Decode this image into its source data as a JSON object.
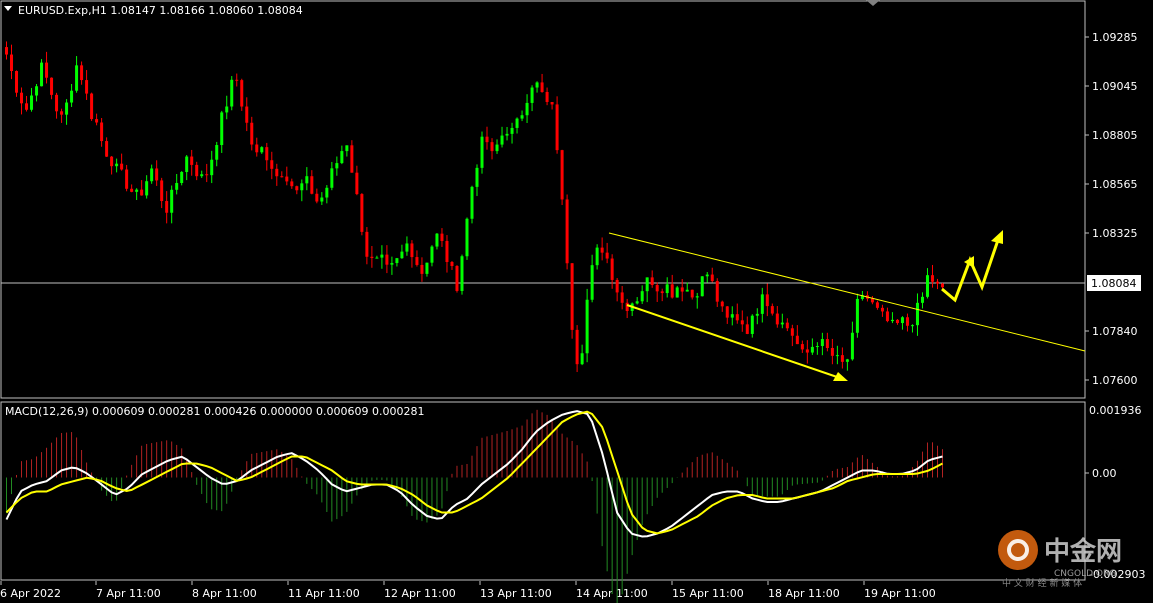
{
  "header": {
    "symbol_line": "EURUSD.Exp,H1  1.08147 1.08166 1.08060 1.08084",
    "macd_line": "MACD(12,26,9) 0.000609 0.000281 0.000426 0.000000 0.000609 0.000281"
  },
  "price_axis": {
    "ticks": [
      "1.09285",
      "1.09045",
      "1.08805",
      "1.08565",
      "1.08325",
      "1.07840",
      "1.07600"
    ],
    "tick_values": [
      1.09285,
      1.09045,
      1.08805,
      1.08565,
      1.08325,
      1.0784,
      1.076
    ],
    "current_price_label": "1.08084",
    "current_price": 1.08084
  },
  "macd_axis": {
    "ticks": [
      "0.001936",
      "0.00",
      "-0.002903"
    ]
  },
  "time_axis": {
    "labels": [
      "6 Apr 2022",
      "7 Apr 11:00",
      "8 Apr 11:00",
      "11 Apr 11:00",
      "12 Apr 11:00",
      "13 Apr 11:00",
      "14 Apr 11:00",
      "15 Apr 11:00",
      "18 Apr 11:00",
      "19 Apr 11:00"
    ]
  },
  "watermark": {
    "brand": "中金网",
    "domain": "CNGOLD.ORG",
    "tagline": "中 文 财 经 新 媒 体"
  },
  "colors": {
    "background": "#000000",
    "bull": "#00ff00",
    "bear": "#ff0000",
    "macd_main": "#ffffff",
    "macd_signal": "#ffff00",
    "hist_pos": "#b22222",
    "hist_neg": "#228b22",
    "annotation": "#ffff00",
    "grid": "#c0c0c0"
  },
  "chart_data": {
    "type": "candlestick",
    "symbol": "EURUSD.Exp",
    "timeframe": "H1",
    "ohlc_last": {
      "open": 1.08147,
      "high": 1.08166,
      "low": 1.0806,
      "close": 1.08084
    },
    "ylim": [
      1.0752,
      1.0962
    ],
    "price_path": [
      1.0935,
      1.0922,
      1.0912,
      1.0905,
      1.0918,
      1.0928,
      1.092,
      1.0908,
      1.09,
      1.0912,
      1.093,
      1.0922,
      1.0905,
      1.0898,
      1.0885,
      1.088,
      1.0872,
      1.0868,
      1.0862,
      1.0858,
      1.0866,
      1.0874,
      1.0862,
      1.0852,
      1.086,
      1.0872,
      1.088,
      1.0876,
      1.0868,
      1.0872,
      1.0885,
      1.09,
      1.0912,
      1.0925,
      1.0908,
      1.0892,
      1.088,
      1.0885,
      1.0878,
      1.087,
      1.0874,
      1.0866,
      1.086,
      1.0868,
      1.0862,
      1.0855,
      1.0862,
      1.0872,
      1.088,
      1.089,
      1.087,
      1.0848,
      1.0828,
      1.0822,
      1.0825,
      1.0818,
      1.0822,
      1.0828,
      1.0835,
      1.0825,
      1.0818,
      1.083,
      1.0838,
      1.0832,
      1.082,
      1.0812,
      1.0835,
      1.0862,
      1.088,
      1.0892,
      1.088,
      1.0888,
      1.0896,
      1.0893,
      1.09,
      1.0912,
      1.0922,
      1.0915,
      1.0908,
      1.0904,
      1.086,
      1.082,
      1.077,
      1.0778,
      1.0812,
      1.0828,
      1.0832,
      1.0822,
      1.081,
      1.08,
      1.0802,
      1.0805,
      1.0812,
      1.0815,
      1.081,
      1.0812,
      1.0808,
      1.0812,
      1.081,
      1.0805,
      1.0812,
      1.0818,
      1.081,
      1.0798,
      1.0792,
      1.0796,
      1.0792,
      1.0788,
      1.0795,
      1.081,
      1.08,
      1.0795,
      1.079,
      1.0788,
      1.078,
      1.0772,
      1.0778,
      1.0782,
      1.0778,
      1.0774,
      1.077,
      1.0768,
      1.0782,
      1.0808,
      1.0805,
      1.08,
      1.0795,
      1.0792,
      1.0788,
      1.0792,
      1.079,
      1.0795,
      1.0803,
      1.0818,
      1.0811,
      1.0808
    ],
    "macd_main_path": [
      -0.0012,
      -0.0004,
      -0.0002,
      -0.0001,
      0.0002,
      0.0003,
      0.0001,
      -0.0002,
      -0.0005,
      -0.0003,
      0.0001,
      0.0003,
      0.0005,
      0.0006,
      0.0003,
      0.0,
      -0.0002,
      -0.0001,
      0.0002,
      0.0004,
      0.0006,
      0.0007,
      0.0005,
      0.0002,
      -0.0002,
      -0.0004,
      -0.0003,
      -0.0002,
      -0.0002,
      -0.0004,
      -0.0008,
      -0.0011,
      -0.0012,
      -0.0008,
      -0.0006,
      -0.0002,
      0.0001,
      0.0004,
      0.0008,
      0.0013,
      0.0016,
      0.0018,
      0.0019,
      0.0018,
      0.0006,
      -0.001,
      -0.0016,
      -0.0017,
      -0.0016,
      -0.0014,
      -0.0011,
      -0.0008,
      -0.0005,
      -0.0004,
      -0.0004,
      -0.0006,
      -0.0007,
      -0.0007,
      -0.0006,
      -0.0005,
      -0.0004,
      -0.0002,
      0.0,
      0.0002,
      0.0002,
      0.0001,
      0.0001,
      0.0002,
      0.0005,
      0.0006
    ],
    "macd_signal_path": [
      -0.001,
      -0.0006,
      -0.0004,
      -0.0004,
      -0.0002,
      -0.0001,
      0.0,
      -0.0001,
      -0.0003,
      -0.0004,
      -0.0002,
      0.0,
      0.0002,
      0.0004,
      0.0004,
      0.0003,
      0.0001,
      -0.0001,
      0.0,
      0.0002,
      0.0004,
      0.0006,
      0.0006,
      0.0004,
      0.0002,
      -0.0001,
      -0.0002,
      -0.0002,
      -0.0002,
      -0.0003,
      -0.0005,
      -0.0008,
      -0.001,
      -0.001,
      -0.0008,
      -0.0006,
      -0.0003,
      0.0,
      0.0004,
      0.0008,
      0.0012,
      0.0016,
      0.0018,
      0.0019,
      0.0014,
      0.0002,
      -0.001,
      -0.0015,
      -0.0016,
      -0.0015,
      -0.0013,
      -0.0011,
      -0.0008,
      -0.0006,
      -0.0005,
      -0.0005,
      -0.0006,
      -0.0006,
      -0.0006,
      -0.0005,
      -0.0004,
      -0.0003,
      -0.0001,
      0.0,
      0.0001,
      0.0001,
      0.0001,
      0.0001,
      0.0002,
      0.0004
    ],
    "macd_ylim": [
      -0.0029,
      0.0021
    ]
  }
}
